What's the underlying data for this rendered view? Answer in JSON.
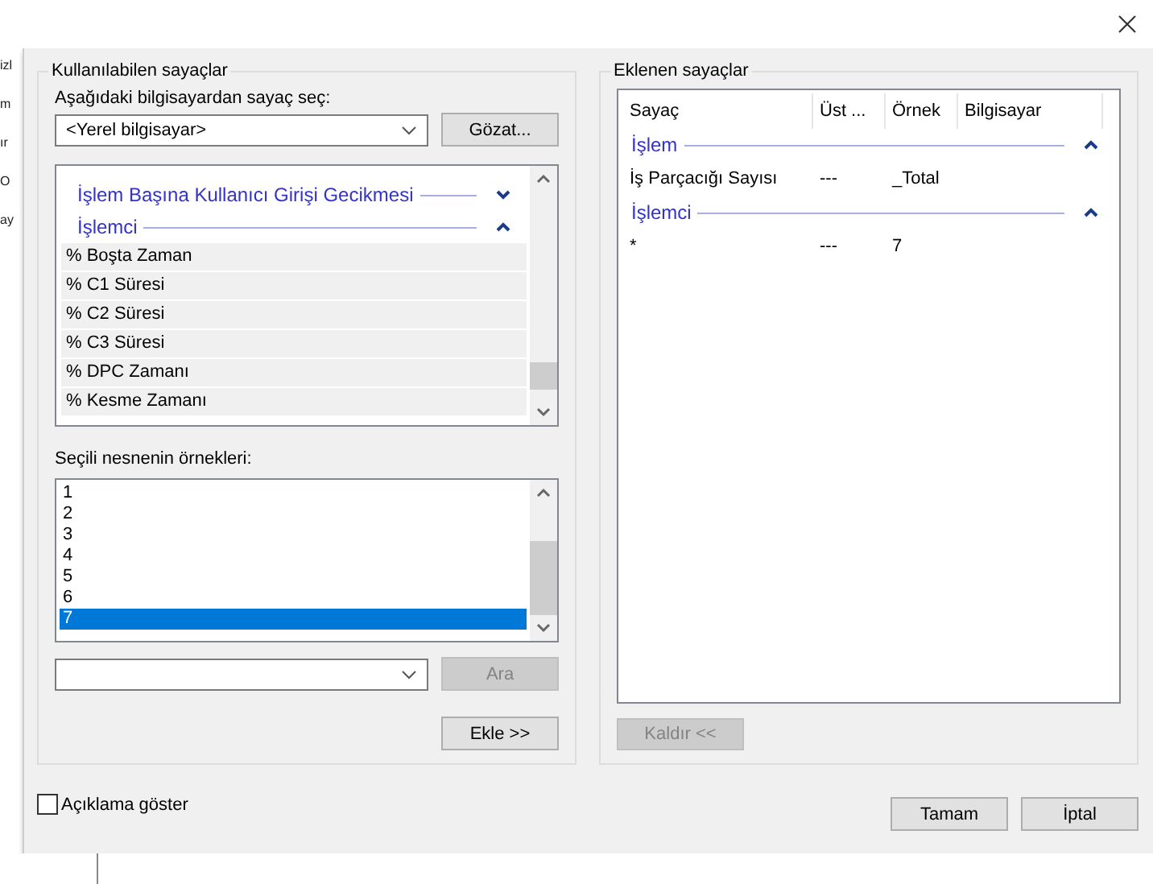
{
  "background_window": {
    "text_fragments": [
      "izl",
      "m",
      "ır",
      "O",
      "ay"
    ]
  },
  "available_counters": {
    "title": "Kullanılabilen sayaçlar",
    "computer_label": "Aşağıdaki bilgisayardan sayaç seç:",
    "computer_select": {
      "value": "<Yerel bilgisayar>"
    },
    "browse_button": "Gözat...",
    "counter_list": [
      {
        "name": "İşlem Başına Kullanıcı Girişi Gecikmesi",
        "expanded": false
      },
      {
        "name": "İşlemci",
        "expanded": true,
        "children": [
          {
            "label": "% Boşta Zaman"
          },
          {
            "label": "% C1 Süresi"
          },
          {
            "label": "% C2 Süresi"
          },
          {
            "label": "% C3 Süresi"
          },
          {
            "label": "% DPC Zamanı"
          },
          {
            "label": "% Kesme Zamanı"
          }
        ]
      }
    ],
    "instances_label": "Seçili nesnenin örnekleri:",
    "instances": [
      {
        "label": "1",
        "selected": false
      },
      {
        "label": "2",
        "selected": false
      },
      {
        "label": "3",
        "selected": false
      },
      {
        "label": "4",
        "selected": false
      },
      {
        "label": "5",
        "selected": false
      },
      {
        "label": "6",
        "selected": false
      },
      {
        "label": "7",
        "selected": true
      }
    ],
    "search_button": {
      "label": "Ara",
      "disabled": true
    },
    "add_button": {
      "label": "Ekle >>",
      "disabled": false
    }
  },
  "added_counters": {
    "title": "Eklenen sayaçlar",
    "columns": [
      "Sayaç",
      "Üst ...",
      "Örnek",
      "Bilgisayar"
    ],
    "groups": [
      {
        "name": "İşlem",
        "expanded": true,
        "rows": [
          [
            "İş Parçacığı Sayısı",
            "---",
            "_Total"
          ]
        ]
      },
      {
        "name": "İşlemci",
        "expanded": true,
        "rows": [
          [
            "*",
            "---",
            "7"
          ]
        ]
      }
    ],
    "remove_button": {
      "label": "Kaldır <<",
      "disabled": true
    }
  },
  "show_description": {
    "label": "Açıklama göster",
    "checked": false
  },
  "buttons": [
    "Tamam",
    "İptal"
  ]
}
